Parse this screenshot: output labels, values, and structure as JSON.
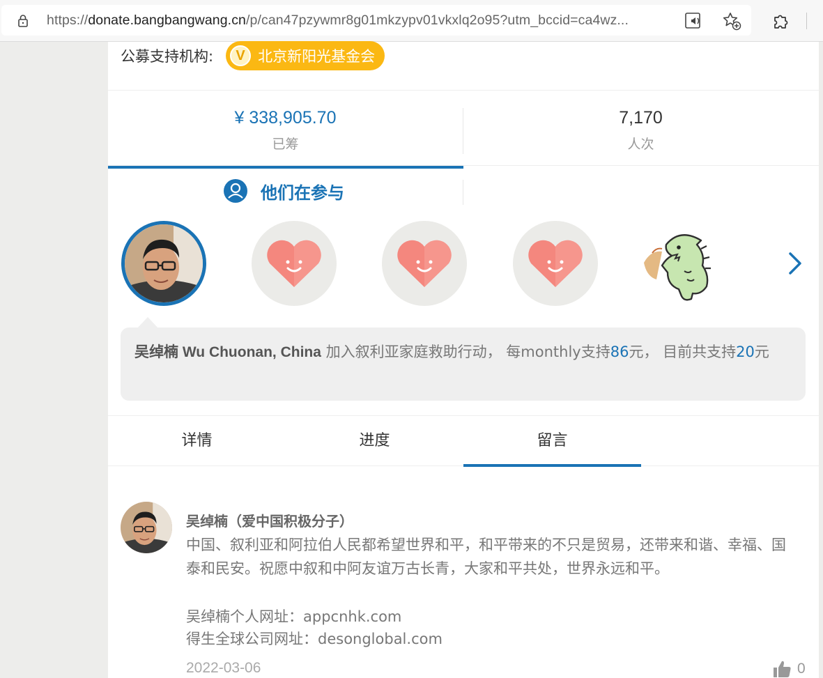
{
  "browser": {
    "url_prefix": "https://",
    "url_host": "donate.bangbangwang.cn",
    "url_path": "/p/can47pzywmr8g01mkzypv01vkxlq2o95?utm_bccid=ca4wz..."
  },
  "org": {
    "label": "公募支持机构:",
    "badge_letter": "V",
    "name": "北京新阳光基金会"
  },
  "stats": {
    "raised_value": "¥ 338,905.70",
    "raised_label": "已筹",
    "count_value": "7,170",
    "count_label": "人次"
  },
  "participants": {
    "title": "他们在参与",
    "activity": {
      "name": "吴绰楠 Wu Chuonan, China",
      "joined": " 加入叙利亚家庭救助行动， 每monthly支持",
      "monthly": "86",
      "unit1": "元， 目前共支持",
      "total": "20",
      "unit2": "元"
    }
  },
  "tabs": [
    "详情",
    "进度",
    "留言"
  ],
  "comment": {
    "author": "吴绰楠（爱中国积极分子）",
    "text": "中国、叙利亚和阿拉伯人民都希望世界和平，和平带来的不只是贸易，还带来和谐、幸福、国泰和民安。祝愿中叙和中阿友谊万古长青，大家和平共处，世界永远和平。",
    "link1": "吴绰楠个人网址：appcnhk.com",
    "link2": "得生全球公司网址：desonglobal.com",
    "date": "2022-03-06",
    "likes": "0"
  },
  "colors": {
    "accent": "#1a73b5",
    "badge": "#fbb813",
    "heart": "#f4877e"
  }
}
